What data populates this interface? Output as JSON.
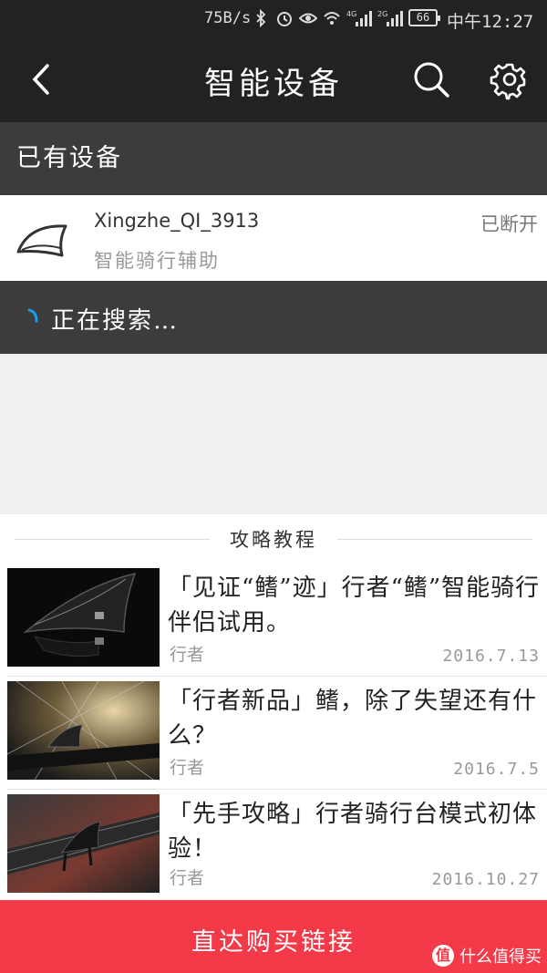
{
  "status_bar": {
    "speed": "75B/s",
    "battery": "66",
    "time": "中午12:27",
    "net_4g": "4G",
    "net_2g": "2G"
  },
  "header": {
    "title": "智能设备"
  },
  "section": {
    "title": "已有设备"
  },
  "device": {
    "name": "Xingzhe_QI_3913",
    "status": "已断开",
    "subtitle": "智能骑行辅助"
  },
  "searching": {
    "label": "正在搜索…",
    "accent_color": "#1e9be6"
  },
  "tutorials": {
    "title": "攻略教程",
    "articles": [
      {
        "title": "「见证“鳍”迹」行者“鳍”智能骑行伴侣试用。",
        "author": "行者",
        "date": "2016.7.13"
      },
      {
        "title": "「行者新品」鳍，除了失望还有什么？",
        "author": "行者",
        "date": "2016.7.5"
      },
      {
        "title": "「先手攻略」行者骑行台模式初体验！",
        "author": "行者",
        "date": "2016.10.27"
      }
    ]
  },
  "buy_bar": {
    "label": "直达购买链接",
    "color": "#f43a48"
  },
  "watermark": {
    "logo": "值",
    "text": "什么值得买"
  }
}
